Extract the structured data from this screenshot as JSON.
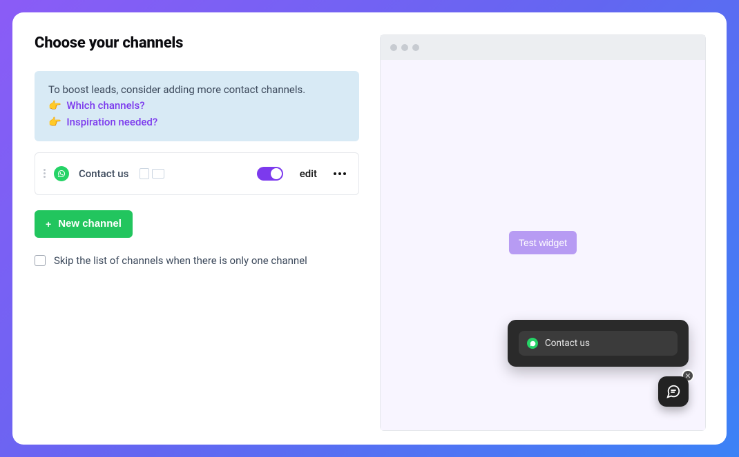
{
  "title": "Choose your channels",
  "info": {
    "lead": "To boost leads, consider adding more contact channels.",
    "link1": "Which channels?",
    "link2": "Inspiration needed?",
    "emoji": "👉"
  },
  "channel": {
    "label": "Contact us",
    "edit": "edit",
    "toggle_on": true
  },
  "new_channel": "New channel",
  "skip_label": "Skip the list of channels when there is only one channel",
  "preview": {
    "test_widget": "Test widget",
    "chat_item": "Contact us"
  }
}
